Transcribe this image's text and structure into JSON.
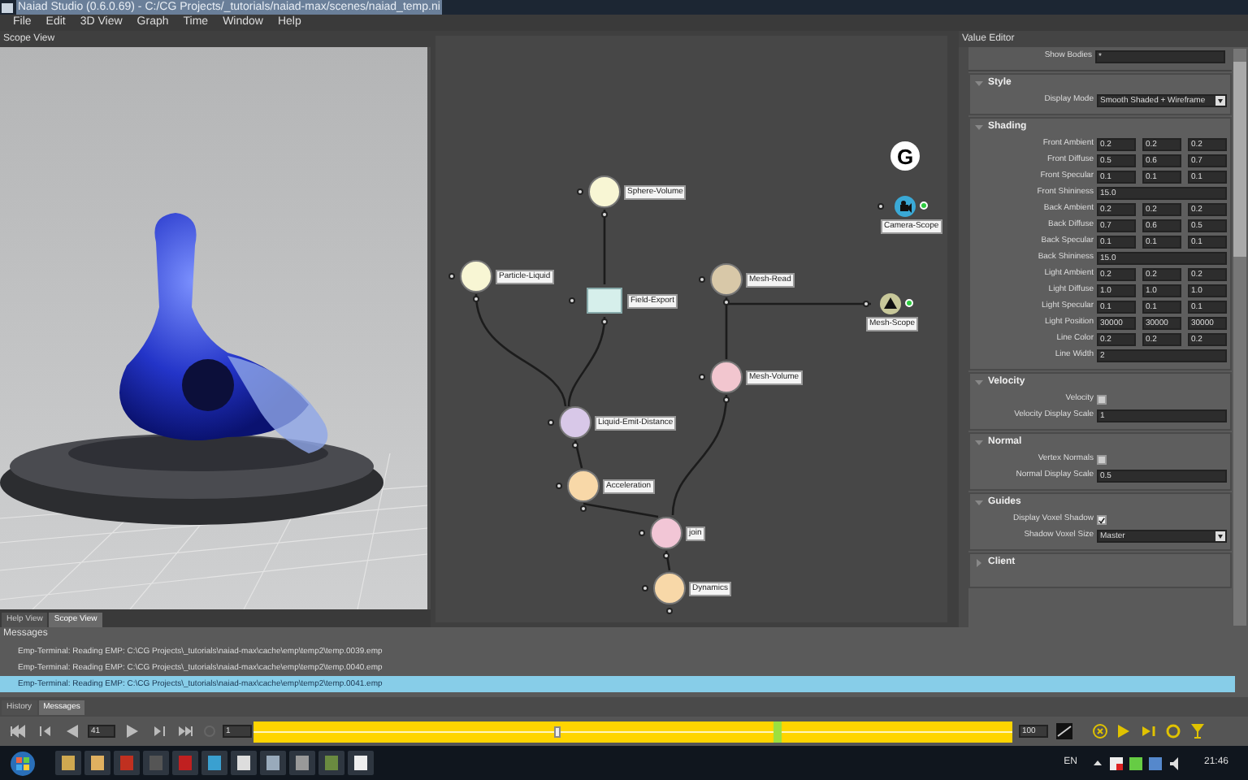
{
  "window": {
    "title": "Naiad Studio (0.6.0.69) - C:/CG Projects/_tutorials/naiad-max/scenes/naiad_temp.ni"
  },
  "menu": [
    "File",
    "Edit",
    "3D View",
    "Graph",
    "Time",
    "Window",
    "Help"
  ],
  "scope_view": {
    "title": "Scope View",
    "tabs": [
      {
        "label": "Help View",
        "selected": false
      },
      {
        "label": "Scope View",
        "selected": true
      }
    ]
  },
  "graph": {
    "logo": "G",
    "nodes": [
      {
        "label": "Sphere-Volume",
        "kind": "circle",
        "color": "#f8f6d4"
      },
      {
        "label": "Particle-Liquid",
        "kind": "circle",
        "color": "#f8f6d4"
      },
      {
        "label": "Field-Export",
        "kind": "box",
        "color": "#d6efeb"
      },
      {
        "label": "Mesh-Read",
        "kind": "circle",
        "color": "#d8c8a8"
      },
      {
        "label": "Mesh-Volume",
        "kind": "circle",
        "color": "#f2c6cf"
      },
      {
        "label": "Camera-Scope",
        "kind": "camera_scope",
        "color": "#3aa9d6"
      },
      {
        "label": "Mesh-Scope",
        "kind": "mesh_scope",
        "color": "#c8c89a"
      },
      {
        "label": "Liquid-Emit-Distance",
        "kind": "circle",
        "color": "#d8c8e8"
      },
      {
        "label": "Acceleration",
        "kind": "circle",
        "color": "#f8d8a8"
      },
      {
        "label": "join",
        "kind": "circle",
        "color": "#f2c6d6"
      },
      {
        "label": "Dynamics",
        "kind": "circle",
        "color": "#f8d8a8"
      }
    ]
  },
  "value_editor": {
    "title": "Value Editor",
    "top_rows": [
      {
        "label": "Show Bodies",
        "kind": "text",
        "value": "*"
      }
    ],
    "sections": [
      {
        "title": "Style",
        "expanded": true,
        "rows": [
          {
            "label": "Display Mode",
            "kind": "dropdown",
            "value": "Smooth Shaded + Wireframe"
          }
        ]
      },
      {
        "title": "Shading",
        "expanded": true,
        "rows": [
          {
            "label": "Front Ambient",
            "kind": "triple",
            "values": [
              "0.2",
              "0.2",
              "0.2"
            ]
          },
          {
            "label": "Front Diffuse",
            "kind": "triple",
            "values": [
              "0.5",
              "0.6",
              "0.7"
            ]
          },
          {
            "label": "Front Specular",
            "kind": "triple",
            "values": [
              "0.1",
              "0.1",
              "0.1"
            ]
          },
          {
            "label": "Front Shininess",
            "kind": "text",
            "value": "15.0"
          },
          {
            "label": "Back Ambient",
            "kind": "triple",
            "values": [
              "0.2",
              "0.2",
              "0.2"
            ]
          },
          {
            "label": "Back Diffuse",
            "kind": "triple",
            "values": [
              "0.7",
              "0.6",
              "0.5"
            ]
          },
          {
            "label": "Back Specular",
            "kind": "triple",
            "values": [
              "0.1",
              "0.1",
              "0.1"
            ]
          },
          {
            "label": "Back Shininess",
            "kind": "text",
            "value": "15.0"
          },
          {
            "label": "Light Ambient",
            "kind": "triple",
            "values": [
              "0.2",
              "0.2",
              "0.2"
            ]
          },
          {
            "label": "Light Diffuse",
            "kind": "triple",
            "values": [
              "1.0",
              "1.0",
              "1.0"
            ]
          },
          {
            "label": "Light Specular",
            "kind": "triple",
            "values": [
              "0.1",
              "0.1",
              "0.1"
            ]
          },
          {
            "label": "Light Position",
            "kind": "triple",
            "values": [
              "30000",
              "30000",
              "30000"
            ]
          },
          {
            "label": "Line Color",
            "kind": "triple",
            "values": [
              "0.2",
              "0.2",
              "0.2"
            ]
          },
          {
            "label": "Line Width",
            "kind": "text",
            "value": "2"
          }
        ]
      },
      {
        "title": "Velocity",
        "expanded": true,
        "rows": [
          {
            "label": "Velocity",
            "kind": "checkbox",
            "checked": false
          },
          {
            "label": "Velocity Display Scale",
            "kind": "text",
            "value": "1"
          }
        ]
      },
      {
        "title": "Normal",
        "expanded": true,
        "rows": [
          {
            "label": "Vertex Normals",
            "kind": "checkbox",
            "checked": false
          },
          {
            "label": "Normal Display Scale",
            "kind": "text",
            "value": "0.5"
          }
        ]
      },
      {
        "title": "Guides",
        "expanded": true,
        "rows": [
          {
            "label": "Display Voxel Shadow",
            "kind": "checkbox",
            "checked": true
          },
          {
            "label": "Shadow Voxel Size",
            "kind": "dropdown",
            "value": "Master"
          }
        ]
      },
      {
        "title": "Client",
        "expanded": false
      }
    ]
  },
  "messages": {
    "title": "Messages",
    "rows": [
      {
        "text": "Emp-Terminal: Reading EMP: C:\\CG Projects\\_tutorials\\naiad-max\\cache\\emp\\temp2\\temp.0039.emp",
        "selected": false
      },
      {
        "text": "Emp-Terminal: Reading EMP: C:\\CG Projects\\_tutorials\\naiad-max\\cache\\emp\\temp2\\temp.0040.emp",
        "selected": false
      },
      {
        "text": "Emp-Terminal: Reading EMP: C:\\CG Projects\\_tutorials\\naiad-max\\cache\\emp\\temp2\\temp.0041.emp",
        "selected": true
      }
    ],
    "tabs": [
      {
        "label": "History",
        "selected": false
      },
      {
        "label": "Messages",
        "selected": true
      }
    ]
  },
  "timeline": {
    "frame": "41",
    "start": "1",
    "end": "100",
    "level": 0.4
  },
  "taskbar": {
    "language": "EN",
    "time": "21:46"
  }
}
